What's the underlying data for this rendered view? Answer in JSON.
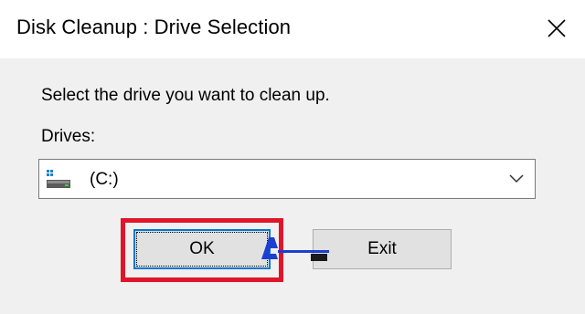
{
  "window": {
    "title": "Disk Cleanup : Drive Selection",
    "close_icon": "close-icon"
  },
  "dialog": {
    "prompt": "Select the drive you want to clean up.",
    "drives_label": "Drives:",
    "selected_drive": "(C:)",
    "drive_icon": "hard-drive-icon",
    "dropdown_icon": "chevron-down-icon"
  },
  "buttons": {
    "ok_label": "OK",
    "exit_label": "Exit"
  },
  "highlight": {
    "color": "#e0152a",
    "target": "ok-button"
  },
  "colors": {
    "focus_border": "#0078d7",
    "dialog_bg": "#f0f0f0"
  }
}
